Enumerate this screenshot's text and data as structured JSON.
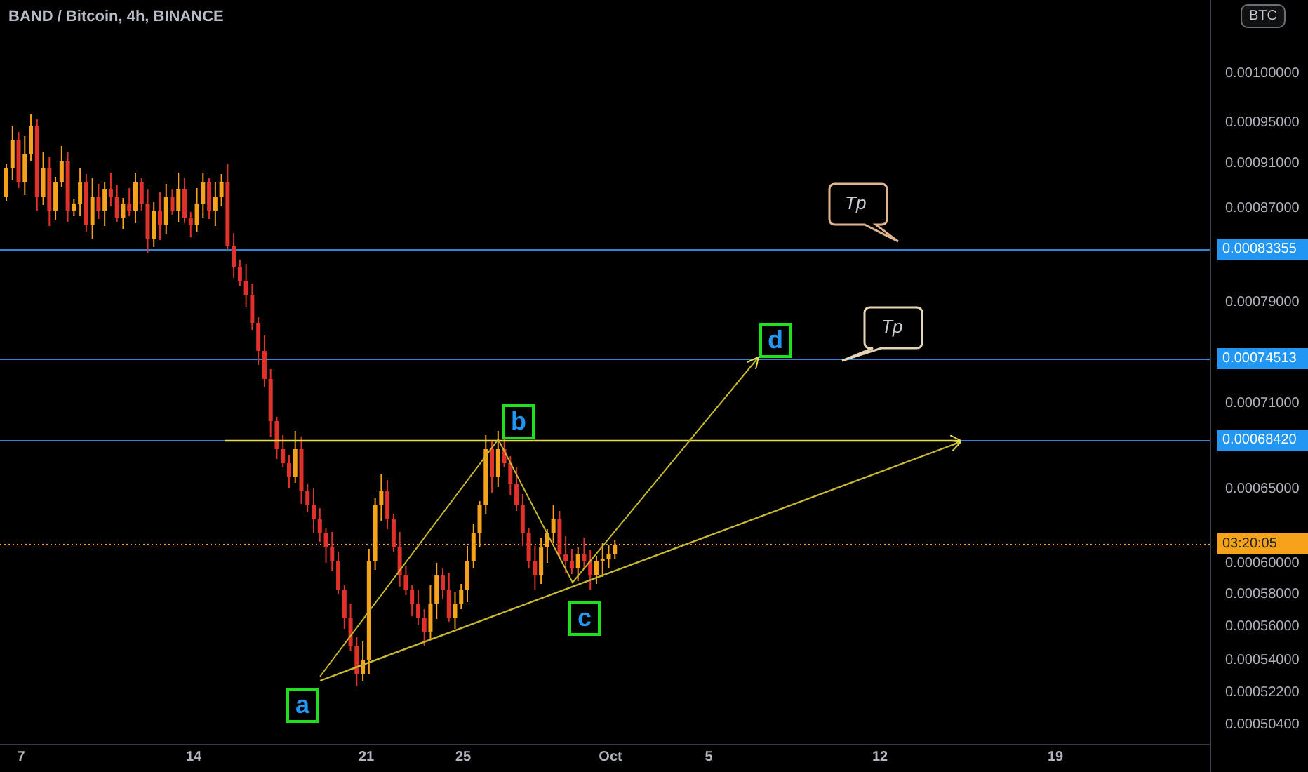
{
  "title": "BAND / Bitcoin, 4h, BINANCE",
  "currency_badge": "BTC",
  "price_axis": {
    "ticks": [
      "0.00100000",
      "0.00095000",
      "0.00091000",
      "0.00087000",
      "0.00079000",
      "0.00071000",
      "0.00065000",
      "0.00060000",
      "0.00058000",
      "0.00056000",
      "0.00054000",
      "0.00052200",
      "0.00050400"
    ]
  },
  "price_labels": [
    {
      "text": "0.00083355",
      "kind": "level"
    },
    {
      "text": "0.00074513",
      "kind": "level"
    },
    {
      "text": "0.00068420",
      "kind": "level"
    },
    {
      "text": "03:20:05",
      "kind": "countdown"
    }
  ],
  "time_axis": {
    "ticks": [
      "7",
      "14",
      "21",
      "25",
      "Oct",
      "5",
      "12",
      "19"
    ]
  },
  "wave_labels": [
    "a",
    "b",
    "c",
    "d"
  ],
  "callouts": [
    "Tp",
    "Tp"
  ]
}
